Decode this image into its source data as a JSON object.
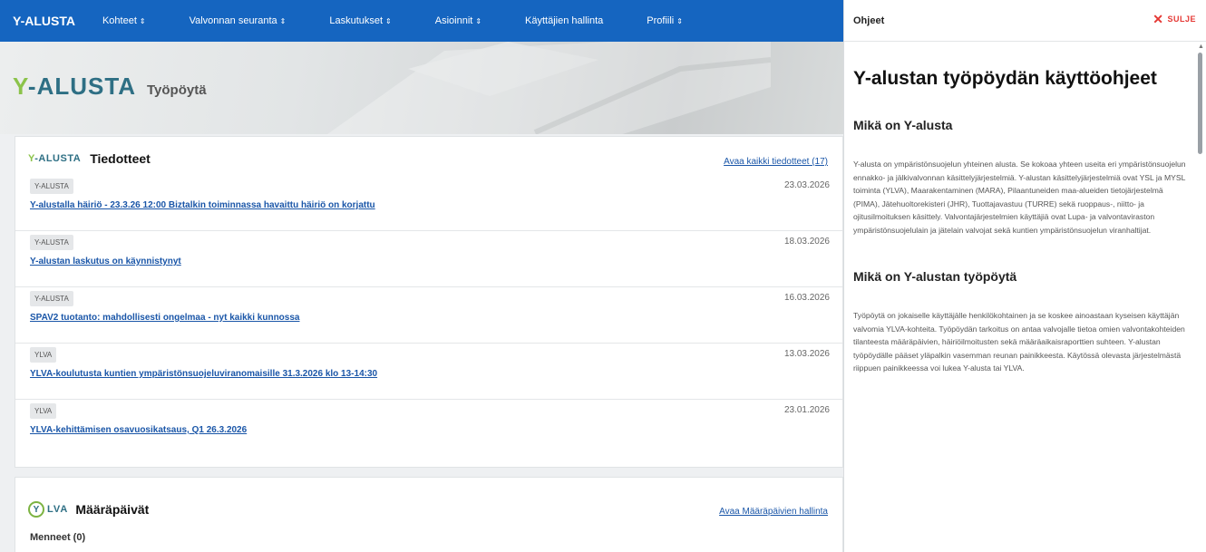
{
  "nav": {
    "brand": "Y-ALUSTA",
    "caret": "⇕",
    "items": [
      {
        "label": "Kohteet",
        "caret": true
      },
      {
        "label": "Valvonnan seuranta",
        "caret": true
      },
      {
        "label": "Laskutukset",
        "caret": true
      },
      {
        "label": "Asioinnit",
        "caret": true
      },
      {
        "label": "Käyttäjien hallinta",
        "caret": false
      },
      {
        "label": "Profiili",
        "caret": true
      }
    ]
  },
  "hero": {
    "logo_y": "Y",
    "logo_rest": "-ALUSTA",
    "subtitle": "Työpöytä"
  },
  "news": {
    "logo_y": "Y",
    "logo_rest": "-ALUSTA",
    "title": "Tiedotteet",
    "open_all": "Avaa kaikki tiedotteet (17)",
    "items": [
      {
        "tag": "Y-ALUSTA",
        "date": "23.03.2026",
        "title": "Y-alustalla häiriö - 23.3.26 12:00 Biztalkin toiminnassa havaittu häiriö on korjattu"
      },
      {
        "tag": "Y-ALUSTA",
        "date": "18.03.2026",
        "title": "Y-alustan laskutus on käynnistynyt"
      },
      {
        "tag": "Y-ALUSTA",
        "date": "16.03.2026",
        "title": "SPAV2 tuotanto: mahdollisesti ongelmaa - nyt kaikki kunnossa"
      },
      {
        "tag": "YLVA",
        "date": "13.03.2026",
        "title": "YLVA-koulutusta kuntien ympäristönsuojeluviranomaisille 31.3.2026 klo 13-14:30"
      },
      {
        "tag": "YLVA",
        "date": "23.01.2026",
        "title": "YLVA-kehittämisen osavuosikatsaus, Q1 26.3.2026"
      }
    ]
  },
  "deadlines": {
    "logo_mark": "Y",
    "logo_text": "LVA",
    "title": "Määräpäivät",
    "manage_link": "Avaa Määräpäivien hallinta",
    "past_label": "Menneet (0)"
  },
  "help": {
    "label": "Ohjeet",
    "close": "SULJE",
    "title": "Y-alustan työpöydän käyttöohjeet",
    "sections": [
      {
        "heading": "Mikä on Y-alusta",
        "text": "Y-alusta on ympäristönsuojelun yhteinen alusta. Se kokoaa yhteen useita eri ympäristönsuojelun ennakko- ja jälkivalvonnan käsittelyjärjestelmiä. Y-alustan käsittelyjärjestelmiä ovat YSL ja MYSL toiminta (YLVA), Maarakentaminen (MARA), Pilaantuneiden maa-alueiden tietojärjestelmä (PIMA), Jätehuoltorekisteri (JHR), Tuottajavastuu (TURRE) sekä ruoppaus-, niitto- ja ojitusilmoituksen käsittely. Valvontajärjestelmien käyttäjiä ovat Lupa- ja valvontaviraston ympäristönsuojelulain ja jätelain valvojat sekä kuntien ympäristönsuojelun viranhaltijat."
      },
      {
        "heading": "Mikä on Y-alustan työpöytä",
        "text": "Työpöytä on jokaiselle käyttäjälle henkilökohtainen ja se koskee ainoastaan kyseisen käyttäjän valvomia YLVA-kohteita. Työpöydän tarkoitus on antaa valvojalle tietoa omien valvontakohteiden tilanteesta määräpäivien, häiriöilmoitusten sekä määräaikaisraporttien suhteen. Y-alustan työpöydälle pääset yläpalkin vasemman reunan painikkeesta. Käytössä olevasta järjestelmästä riippuen painikkeessa voi lukea Y-alusta tai YLVA."
      }
    ]
  },
  "colors": {
    "nav": "#1565c0",
    "link": "#1a56a8",
    "close": "#e53935",
    "logo_green": "#8bc34a",
    "logo_teal": "#2e6f84"
  },
  "icons": {
    "close": "close-icon",
    "caret": "sort-caret-icon",
    "scroll_up": "scroll-up-arrow-icon"
  }
}
